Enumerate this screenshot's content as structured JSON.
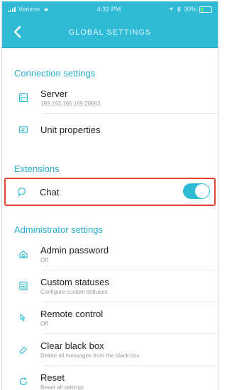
{
  "status_bar": {
    "carrier": "Verizon",
    "time": "4:32 PM",
    "battery": "30%",
    "battery_level": 0.3
  },
  "header": {
    "title": "GLOBAL SETTINGS"
  },
  "sections": {
    "connection": {
      "label": "Connection settings",
      "server": {
        "title": "Server",
        "subtitle": "193.193.165.165:20963"
      },
      "unit_properties": {
        "title": "Unit properties"
      }
    },
    "extensions": {
      "label": "Extensions",
      "chat": {
        "title": "Chat",
        "enabled": true
      }
    },
    "administrator": {
      "label": "Administrator settings",
      "admin_password": {
        "title": "Admin password",
        "subtitle": "Off"
      },
      "custom_statuses": {
        "title": "Custom statuses",
        "subtitle": "Configure custom statuses"
      },
      "remote_control": {
        "title": "Remote control",
        "subtitle": "Off"
      },
      "clear_black_box": {
        "title": "Clear black box",
        "subtitle": "Delete all messages from the black box"
      },
      "reset": {
        "title": "Reset",
        "subtitle": "Reset all settings"
      }
    }
  },
  "colors": {
    "accent": "#2fbad6",
    "section_header": "#27aed0",
    "highlight_border": "#e0442f"
  }
}
